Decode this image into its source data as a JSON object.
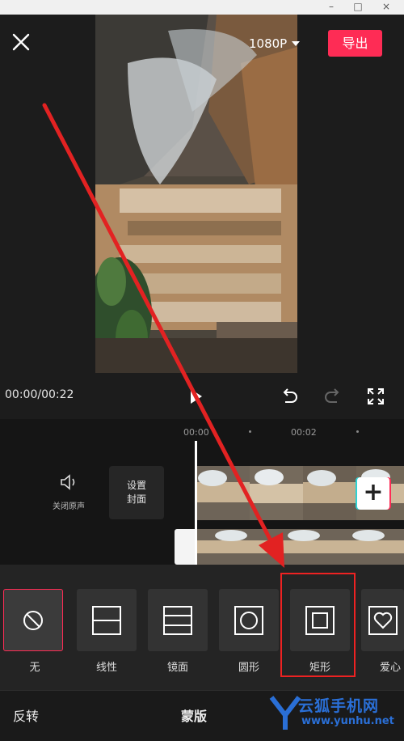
{
  "window": {
    "minimize": "–",
    "maximize": "□",
    "close": "×"
  },
  "header": {
    "resolution": "1080P",
    "export_label": "导出"
  },
  "playback": {
    "timecode": "00:00/00:22"
  },
  "timeline": {
    "ruler": [
      "00:00",
      "00:02"
    ],
    "mute_label": "关闭原声",
    "cover_line1": "设置",
    "cover_line2": "封面",
    "add_label": "+"
  },
  "masks": {
    "items": [
      {
        "label": "无",
        "icon": "none-icon"
      },
      {
        "label": "线性",
        "icon": "linear-mask-icon"
      },
      {
        "label": "镜面",
        "icon": "mirror-mask-icon"
      },
      {
        "label": "圆形",
        "icon": "circle-mask-icon"
      },
      {
        "label": "矩形",
        "icon": "rectangle-mask-icon"
      },
      {
        "label": "爱心",
        "icon": "heart-mask-icon"
      }
    ],
    "selected": "无",
    "highlighted": "矩形"
  },
  "bottom": {
    "left": "反转",
    "title": "蒙版"
  },
  "watermark": {
    "brand": "云狐手机网",
    "url": "www.yunhu.net"
  },
  "colors": {
    "accent": "#fe2c55",
    "annotation": "#e22222",
    "background": "#1c1c1c"
  }
}
